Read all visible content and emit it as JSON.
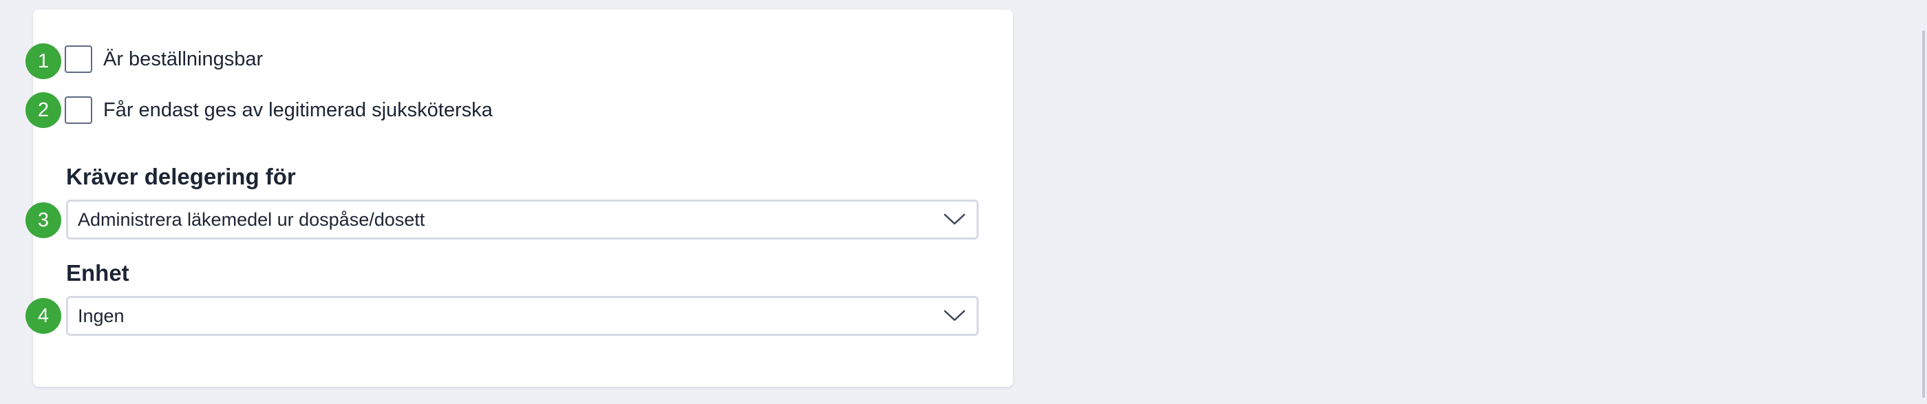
{
  "form": {
    "checkboxes": [
      {
        "number": "1",
        "label": "Är beställningsbar",
        "checked": false
      },
      {
        "number": "2",
        "label": "Får endast ges av legitimerad sjuksköterska",
        "checked": false
      }
    ],
    "delegation": {
      "number": "3",
      "title": "Kräver delegering för",
      "value": "Administrera läkemedel ur dospåse/dosett"
    },
    "unit": {
      "number": "4",
      "title": "Enhet",
      "value": "Ingen"
    }
  },
  "colors": {
    "page_background": "#eff0f5",
    "badge": "#3aa83a",
    "text": "#1d2433",
    "field_border": "#d7dae3"
  },
  "icons": {
    "select_arrow": "chevron-down-icon"
  }
}
